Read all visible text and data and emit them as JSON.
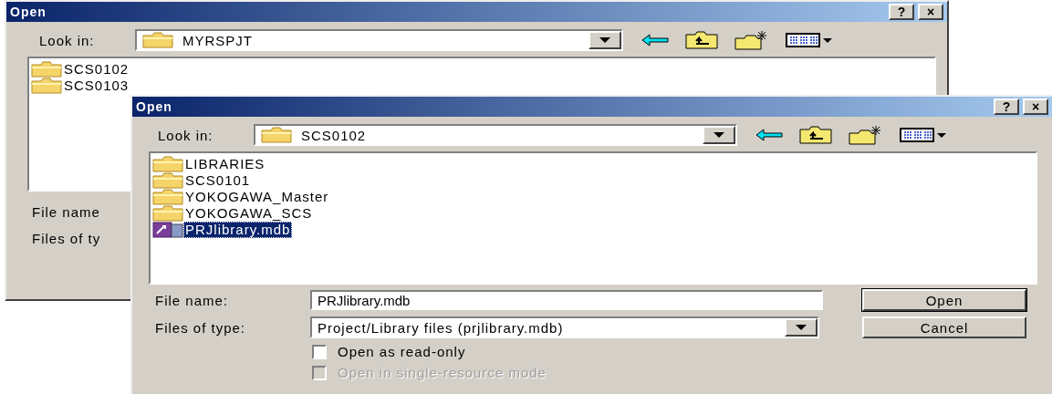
{
  "windows": [
    {
      "title": "Open",
      "title_buttons": [
        "?",
        "×"
      ],
      "look_in": {
        "label": "Look in:",
        "value": "MYRSPJT"
      },
      "files": [
        {
          "name": "SCS0102",
          "kind": "folder",
          "selected": false
        },
        {
          "name": "SCS0103",
          "kind": "folder",
          "selected": false
        }
      ],
      "fields": [
        {
          "label": "File name"
        },
        {
          "label": "Files of ty"
        }
      ]
    },
    {
      "title": "Open",
      "title_buttons": [
        "?",
        "×"
      ],
      "look_in": {
        "label": "Look in:",
        "value": "SCS0102"
      },
      "files": [
        {
          "name": "LIBRARIES",
          "kind": "folder",
          "selected": false
        },
        {
          "name": "SCS0101",
          "kind": "folder",
          "selected": false
        },
        {
          "name": "YOKOGAWA_Master",
          "kind": "folder",
          "selected": false
        },
        {
          "name": "YOKOGAWA_SCS",
          "kind": "folder",
          "selected": false
        },
        {
          "name": "PRJlibrary.mdb",
          "kind": "file",
          "selected": true
        }
      ],
      "fields": [
        {
          "label": "File name:",
          "kind": "text",
          "value": "PRJlibrary.mdb",
          "button": "Open",
          "default": true
        },
        {
          "label": "Files of type:",
          "kind": "combo",
          "value": "Project/Library files (prjlibrary.mdb)",
          "button": "Cancel",
          "default": false
        }
      ],
      "options": [
        {
          "label": "Open as read-only",
          "checked": false,
          "disabled": false
        },
        {
          "label": "Open in single-resource mode",
          "checked": false,
          "disabled": true
        }
      ]
    }
  ]
}
